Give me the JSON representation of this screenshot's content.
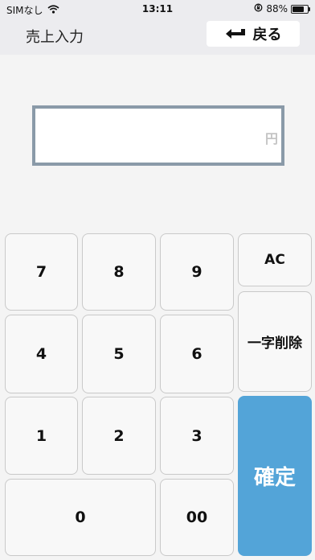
{
  "status_bar": {
    "carrier": "SIMなし",
    "time": "13:11",
    "battery_level": "88%",
    "battery_fraction": 0.88
  },
  "header": {
    "title": "売上入力",
    "back_label": "戻る"
  },
  "amount": {
    "value": "",
    "unit": "円"
  },
  "keypad": {
    "digits": [
      "7",
      "8",
      "9",
      "4",
      "5",
      "6",
      "1",
      "2",
      "3",
      "0",
      "00"
    ],
    "clear_label": "AC",
    "delete_label": "一字削除",
    "confirm_label": "確定"
  },
  "colors": {
    "confirm": "#53a4d8",
    "input_border": "#8a9aa8",
    "header_bg": "#ececef"
  }
}
